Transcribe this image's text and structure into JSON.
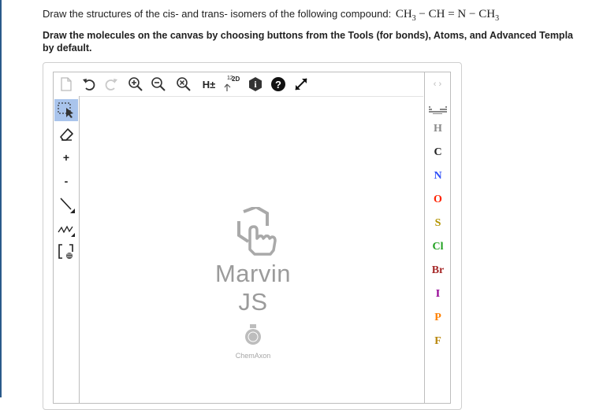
{
  "question": {
    "prefix": "Draw the structures of the cis- and trans- isomers of the following compound:",
    "formula": {
      "ch3_a": "CH",
      "sub_a": "3",
      "mid": " − CH = N − ",
      "ch3_b": "CH",
      "sub_b": "3"
    }
  },
  "instructions": {
    "line1": "Draw the molecules on the canvas by choosing buttons from the Tools (for bonds), Atoms, and Advanced Templa",
    "line2": "by default."
  },
  "toolbar": {
    "hydrogen_label": "H±",
    "clean2d_label": "2D",
    "clean2d_superscript": "12",
    "help_label": "?",
    "info_label": "i",
    "panel_arrows": "‹ ›"
  },
  "left_tools": [
    {
      "name": "select-tool",
      "icon": "rectangle-select-icon"
    },
    {
      "name": "erase-tool",
      "icon": "eraser-icon"
    },
    {
      "name": "increase-charge-tool",
      "label": "+"
    },
    {
      "name": "decrease-charge-tool",
      "label": "-"
    },
    {
      "name": "single-bond-tool",
      "icon": "single-bond-icon"
    },
    {
      "name": "chain-tool",
      "icon": "chain-icon"
    },
    {
      "name": "sgroup-bracket-tool",
      "icon": "bracket-icon"
    }
  ],
  "atoms": [
    {
      "symbol": "H",
      "color": "#8a8a8a"
    },
    {
      "symbol": "C",
      "color": "#222222"
    },
    {
      "symbol": "N",
      "color": "#3050f8"
    },
    {
      "symbol": "O",
      "color": "#ff2200"
    },
    {
      "symbol": "S",
      "color": "#b39400"
    },
    {
      "symbol": "Cl",
      "color": "#1fa01f"
    },
    {
      "symbol": "Br",
      "color": "#a62929"
    },
    {
      "symbol": "I",
      "color": "#940094"
    },
    {
      "symbol": "P",
      "color": "#ff8000"
    },
    {
      "symbol": "F",
      "color": "#b8860b"
    }
  ],
  "logo": {
    "name": "Marvin JS",
    "brand": "ChemAxon"
  }
}
